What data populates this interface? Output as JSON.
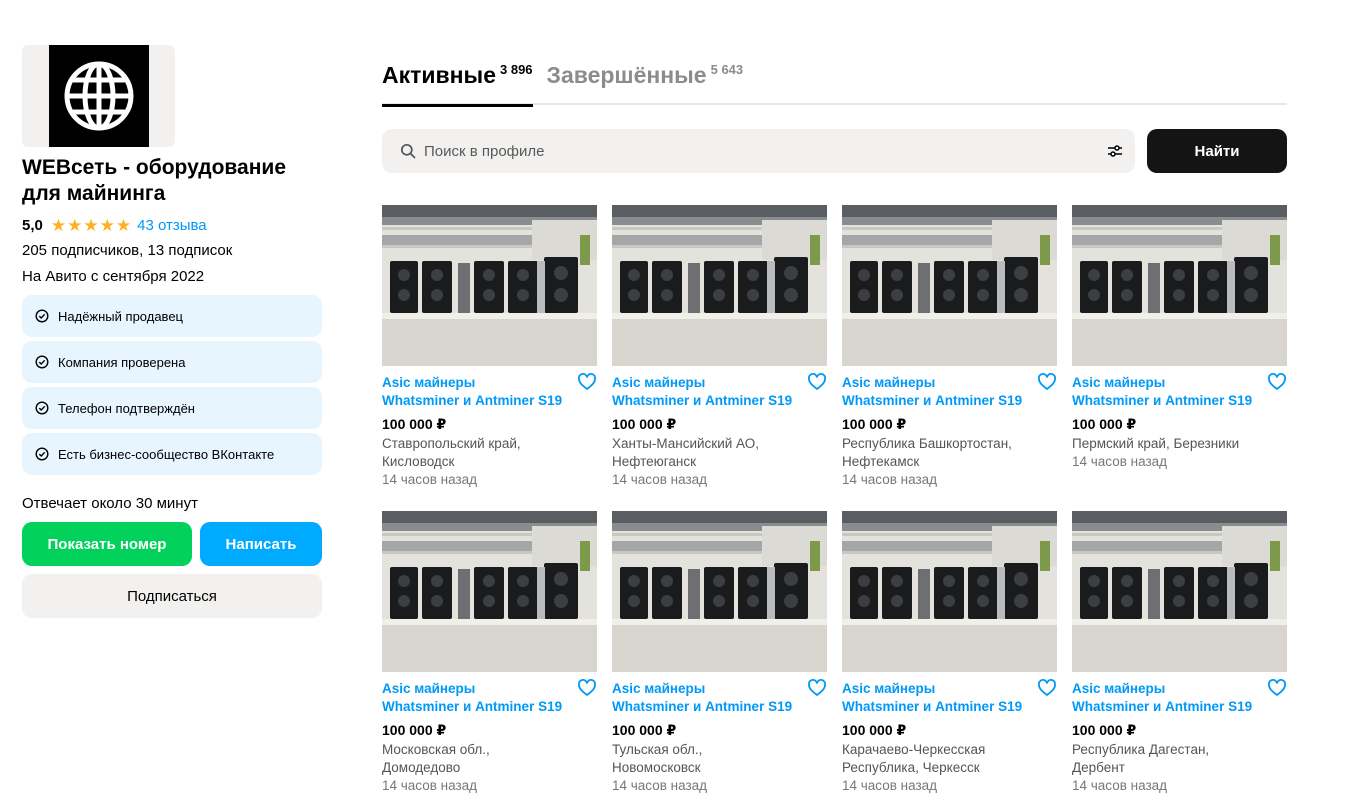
{
  "seller": {
    "name": "WEBсеть - оборудование для майнинга",
    "rating": "5,0",
    "reviews": "43 отзыва",
    "subscribers": "205 подписчиков, 13 подписок",
    "since": "На Авито с сентября 2022",
    "badges": [
      "Надёжный продавец",
      "Компания проверена",
      "Телефон подтверждён",
      "Есть бизнес-сообщество ВКонтакте"
    ],
    "response_time": "Отвечает около 30 минут",
    "show_phone_label": "Показать номер",
    "write_label": "Написать",
    "subscribe_label": "Подписаться"
  },
  "tabs": [
    {
      "label": "Активные",
      "count": "3 896",
      "active": true
    },
    {
      "label": "Завершённые",
      "count": "5 643",
      "active": false
    }
  ],
  "search": {
    "placeholder": "Поиск в профиле",
    "button_label": "Найти"
  },
  "colors": {
    "accent_blue": "#0099f7",
    "star": "#ffb021",
    "green_button": "#02d15c",
    "blue_button": "#00aaff",
    "badge_bg": "#e6f5fe"
  },
  "listings": [
    {
      "title_line1": "Asic майнеры",
      "title_line2": "Whatsminer и Antminer S19",
      "price": "100 000 ₽",
      "loc1": "Ставропольский край,",
      "loc2": "Кисловодск",
      "time": "14 часов назад"
    },
    {
      "title_line1": "Asic майнеры",
      "title_line2": "Whatsminer и Antminer S19",
      "price": "100 000 ₽",
      "loc1": "Ханты-Мансийский АО,",
      "loc2": "Нефтеюганск",
      "time": "14 часов назад"
    },
    {
      "title_line1": "Asic майнеры",
      "title_line2": "Whatsminer и Antminer S19",
      "price": "100 000 ₽",
      "loc1": "Республика Башкортостан,",
      "loc2": "Нефтекамск",
      "time": "14 часов назад"
    },
    {
      "title_line1": "Asic майнеры",
      "title_line2": "Whatsminer и Antminer S19",
      "price": "100 000 ₽",
      "loc1": "Пермский край, Березники",
      "loc2": "",
      "time": "14 часов назад"
    },
    {
      "title_line1": "Asic майнеры",
      "title_line2": "Whatsminer и Antminer S19",
      "price": "100 000 ₽",
      "loc1": "Московская обл.,",
      "loc2": "Домодедово",
      "time": "14 часов назад"
    },
    {
      "title_line1": "Asic майнеры",
      "title_line2": "Whatsminer и Antminer S19",
      "price": "100 000 ₽",
      "loc1": "Тульская обл.,",
      "loc2": "Новомосковск",
      "time": "14 часов назад"
    },
    {
      "title_line1": "Asic майнеры",
      "title_line2": "Whatsminer и Antminer S19",
      "price": "100 000 ₽",
      "loc1": "Карачаево-Черкесская",
      "loc2": "Республика, Черкесск",
      "time": "14 часов назад"
    },
    {
      "title_line1": "Asic майнеры",
      "title_line2": "Whatsminer и Antminer S19",
      "price": "100 000 ₽",
      "loc1": "Республика Дагестан,",
      "loc2": "Дербент",
      "time": "14 часов назад"
    }
  ]
}
